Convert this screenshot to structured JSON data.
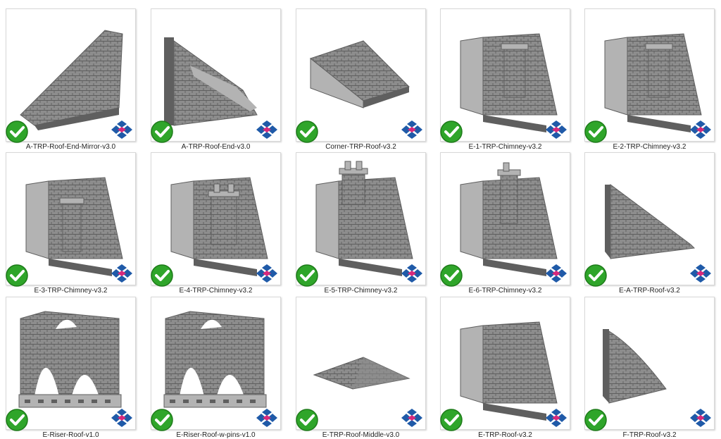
{
  "files": [
    {
      "name": "A-TRP-Roof-End-Mirror-v3.0",
      "shape": "slope-left",
      "status": "check-icon",
      "badge": "app-logo-icon"
    },
    {
      "name": "A-TRP-Roof-End-v3.0",
      "shape": "slope-wall",
      "status": "check-icon",
      "badge": "app-logo-icon"
    },
    {
      "name": "Corner-TRP-Roof-v3.2",
      "shape": "corner",
      "status": "check-icon",
      "badge": "app-logo-icon"
    },
    {
      "name": "E-1-TRP-Chimney-v3.2",
      "shape": "chimney-box",
      "status": "check-icon",
      "badge": "app-logo-icon"
    },
    {
      "name": "E-2-TRP-Chimney-v3.2",
      "shape": "chimney-box",
      "status": "check-icon",
      "badge": "app-logo-icon"
    },
    {
      "name": "E-3-TRP-Chimney-v3.2",
      "shape": "chimney-small",
      "status": "check-icon",
      "badge": "app-logo-icon"
    },
    {
      "name": "E-4-TRP-Chimney-v3.2",
      "shape": "chimney-pots",
      "status": "check-icon",
      "badge": "app-logo-icon"
    },
    {
      "name": "E-5-TRP-Chimney-v3.2",
      "shape": "chimney-top",
      "status": "check-icon",
      "badge": "app-logo-icon"
    },
    {
      "name": "E-6-TRP-Chimney-v3.2",
      "shape": "chimney-tall",
      "status": "check-icon",
      "badge": "app-logo-icon"
    },
    {
      "name": "E-A-TRP-Roof-v3.2",
      "shape": "slope-thin",
      "status": "check-icon",
      "badge": "app-logo-icon"
    },
    {
      "name": "E-Riser-Roof-v1.0",
      "shape": "riser",
      "status": "check-icon",
      "badge": "app-logo-icon"
    },
    {
      "name": "E-Riser-Roof-w-pins-v1.0",
      "shape": "riser",
      "status": "check-icon",
      "badge": "app-logo-icon"
    },
    {
      "name": "E-TRP-Roof-Middle-v3.0",
      "shape": "flat-pyramid",
      "status": "check-icon",
      "badge": "app-logo-icon"
    },
    {
      "name": "E-TRP-Roof-v3.2",
      "shape": "slope-plain",
      "status": "check-icon",
      "badge": "app-logo-icon"
    },
    {
      "name": "F-TRP-Roof-v3.2",
      "shape": "slope-curve",
      "status": "check-icon",
      "badge": "app-logo-icon"
    }
  ],
  "colors": {
    "model": "#8d8d8d",
    "model_dark": "#5f5f5f",
    "model_light": "#b3b3b3",
    "check": "#2fa52a",
    "logo_blue": "#1f5aa8",
    "logo_pink": "#d62a7c"
  }
}
